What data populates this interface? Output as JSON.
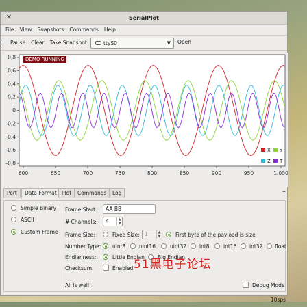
{
  "window": {
    "title": "SerialPlot",
    "close_glyph": "✕"
  },
  "menu": [
    "File",
    "View",
    "Snapshots",
    "Commands",
    "Help"
  ],
  "toolbar": {
    "pause": "Pause",
    "clear": "Clear",
    "take_snapshot": "Take Snapshot",
    "port": "ttyS0",
    "open": "Open"
  },
  "plot": {
    "badge": "DEMO RUNNING",
    "x_ticks": [
      "600",
      "650",
      "700",
      "750",
      "800",
      "850",
      "900",
      "950",
      "1.000"
    ],
    "y_ticks": [
      "0,8",
      "0,6",
      "0,4",
      "0,2",
      "0",
      "-0,2",
      "-0,4",
      "-0,6",
      "-0,8"
    ],
    "legend": [
      {
        "name": "X",
        "color": "#d42027"
      },
      {
        "name": "Y",
        "color": "#8ed43a"
      },
      {
        "name": "Z",
        "color": "#2fb8d6"
      },
      {
        "name": "T",
        "color": "#8a2fd4"
      }
    ]
  },
  "tabs": [
    "Port",
    "Data Format",
    "Plot",
    "Commands",
    "Log"
  ],
  "format": {
    "simple_binary": "Simple Binary",
    "ascii": "ASCII",
    "custom_frame": "Custom Frame",
    "frame_start_label": "Frame Start:",
    "frame_start_value": "AA BB",
    "channels_label": "# Channels:",
    "channels_value": "4",
    "frame_size_label": "Frame Size:",
    "fixed_size": "Fixed Size:",
    "fixed_size_value": "1",
    "first_byte": "First byte of the payload is size",
    "number_type_label": "Number Type:",
    "number_types": [
      "uint8",
      "uint16",
      "uint32",
      "int8",
      "int16",
      "int32",
      "float"
    ],
    "endianness_label": "Endianness:",
    "little_endian": "Little Endian",
    "big_endian": "Big Endian",
    "checksum_label": "Checksum:",
    "enabled": "Enabled",
    "status": "All is well!",
    "debug_mode": "Debug Mode"
  },
  "status": {
    "rate": "10sps"
  },
  "watermark": "51黑电子论坛"
}
